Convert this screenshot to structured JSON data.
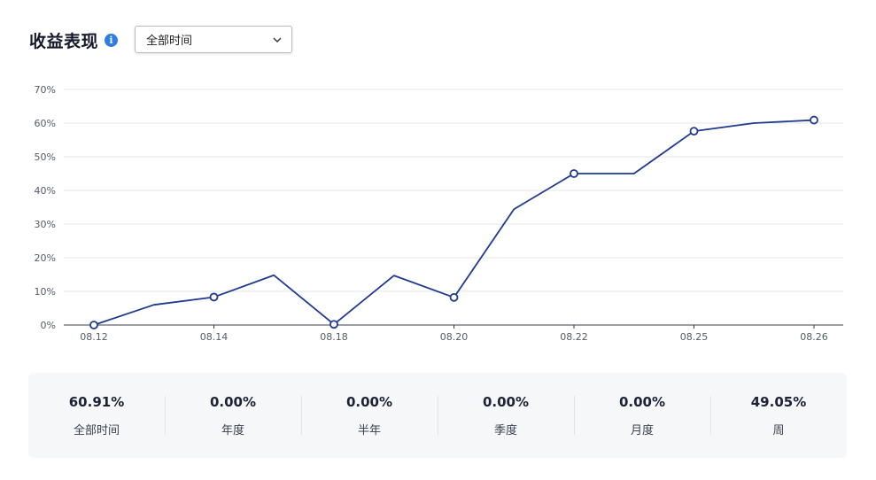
{
  "header": {
    "title": "收益表现",
    "info_icon": "info-icon"
  },
  "filter": {
    "selected": "全部时间"
  },
  "chart_data": {
    "type": "line",
    "title": "",
    "xlabel": "",
    "ylabel": "",
    "ylim": [
      0,
      70
    ],
    "y_ticks": [
      "0%",
      "10%",
      "20%",
      "30%",
      "40%",
      "50%",
      "60%",
      "70%"
    ],
    "x_tick_labels": [
      "08.12",
      "08.14",
      "08.18",
      "08.20",
      "08.22",
      "08.25",
      "08.26"
    ],
    "grid": true,
    "line_color": "#1f3a8f",
    "series": [
      {
        "values": [
          0,
          6,
          8.3,
          14.8,
          0.2,
          14.7,
          8.2,
          34.4,
          45,
          45,
          57.6,
          60,
          60.9
        ],
        "markers": [
          true,
          false,
          true,
          false,
          true,
          false,
          true,
          false,
          true,
          false,
          true,
          false,
          true
        ]
      }
    ]
  },
  "stats": [
    {
      "value": "60.91%",
      "label": "全部时间"
    },
    {
      "value": "0.00%",
      "label": "年度"
    },
    {
      "value": "0.00%",
      "label": "半年"
    },
    {
      "value": "0.00%",
      "label": "季度"
    },
    {
      "value": "0.00%",
      "label": "月度"
    },
    {
      "value": "49.05%",
      "label": "周"
    }
  ]
}
